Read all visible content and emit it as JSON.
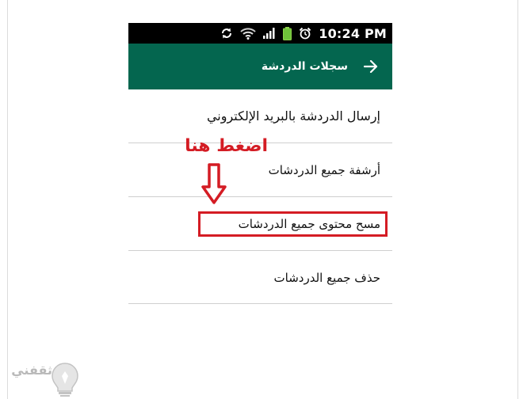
{
  "status_bar": {
    "time": "10:24 PM",
    "icons": [
      "sync-icon",
      "wifi-icon",
      "signal-icon",
      "battery-icon",
      "alarm-icon"
    ]
  },
  "app_bar": {
    "title": "سجلات الدردشة",
    "back_icon": "arrow-right-icon"
  },
  "menu": {
    "items": [
      {
        "label": "إرسال الدردشة بالبريد الإلكتروني"
      },
      {
        "label": "أرشفة جميع الدردشات"
      },
      {
        "label": "مسح محتوى جميع الدردشات"
      },
      {
        "label": "حذف جميع الدردشات"
      }
    ]
  },
  "annotation": {
    "text": "اضغط هنا",
    "color": "#d41c24",
    "arrow_icon": "down-arrow-icon"
  },
  "watermark": {
    "text": "ثقفني",
    "icon": "lightbulb-icon"
  },
  "colors": {
    "app_bar": "#04664f",
    "status_bar": "#000000",
    "highlight": "#d41c24"
  }
}
